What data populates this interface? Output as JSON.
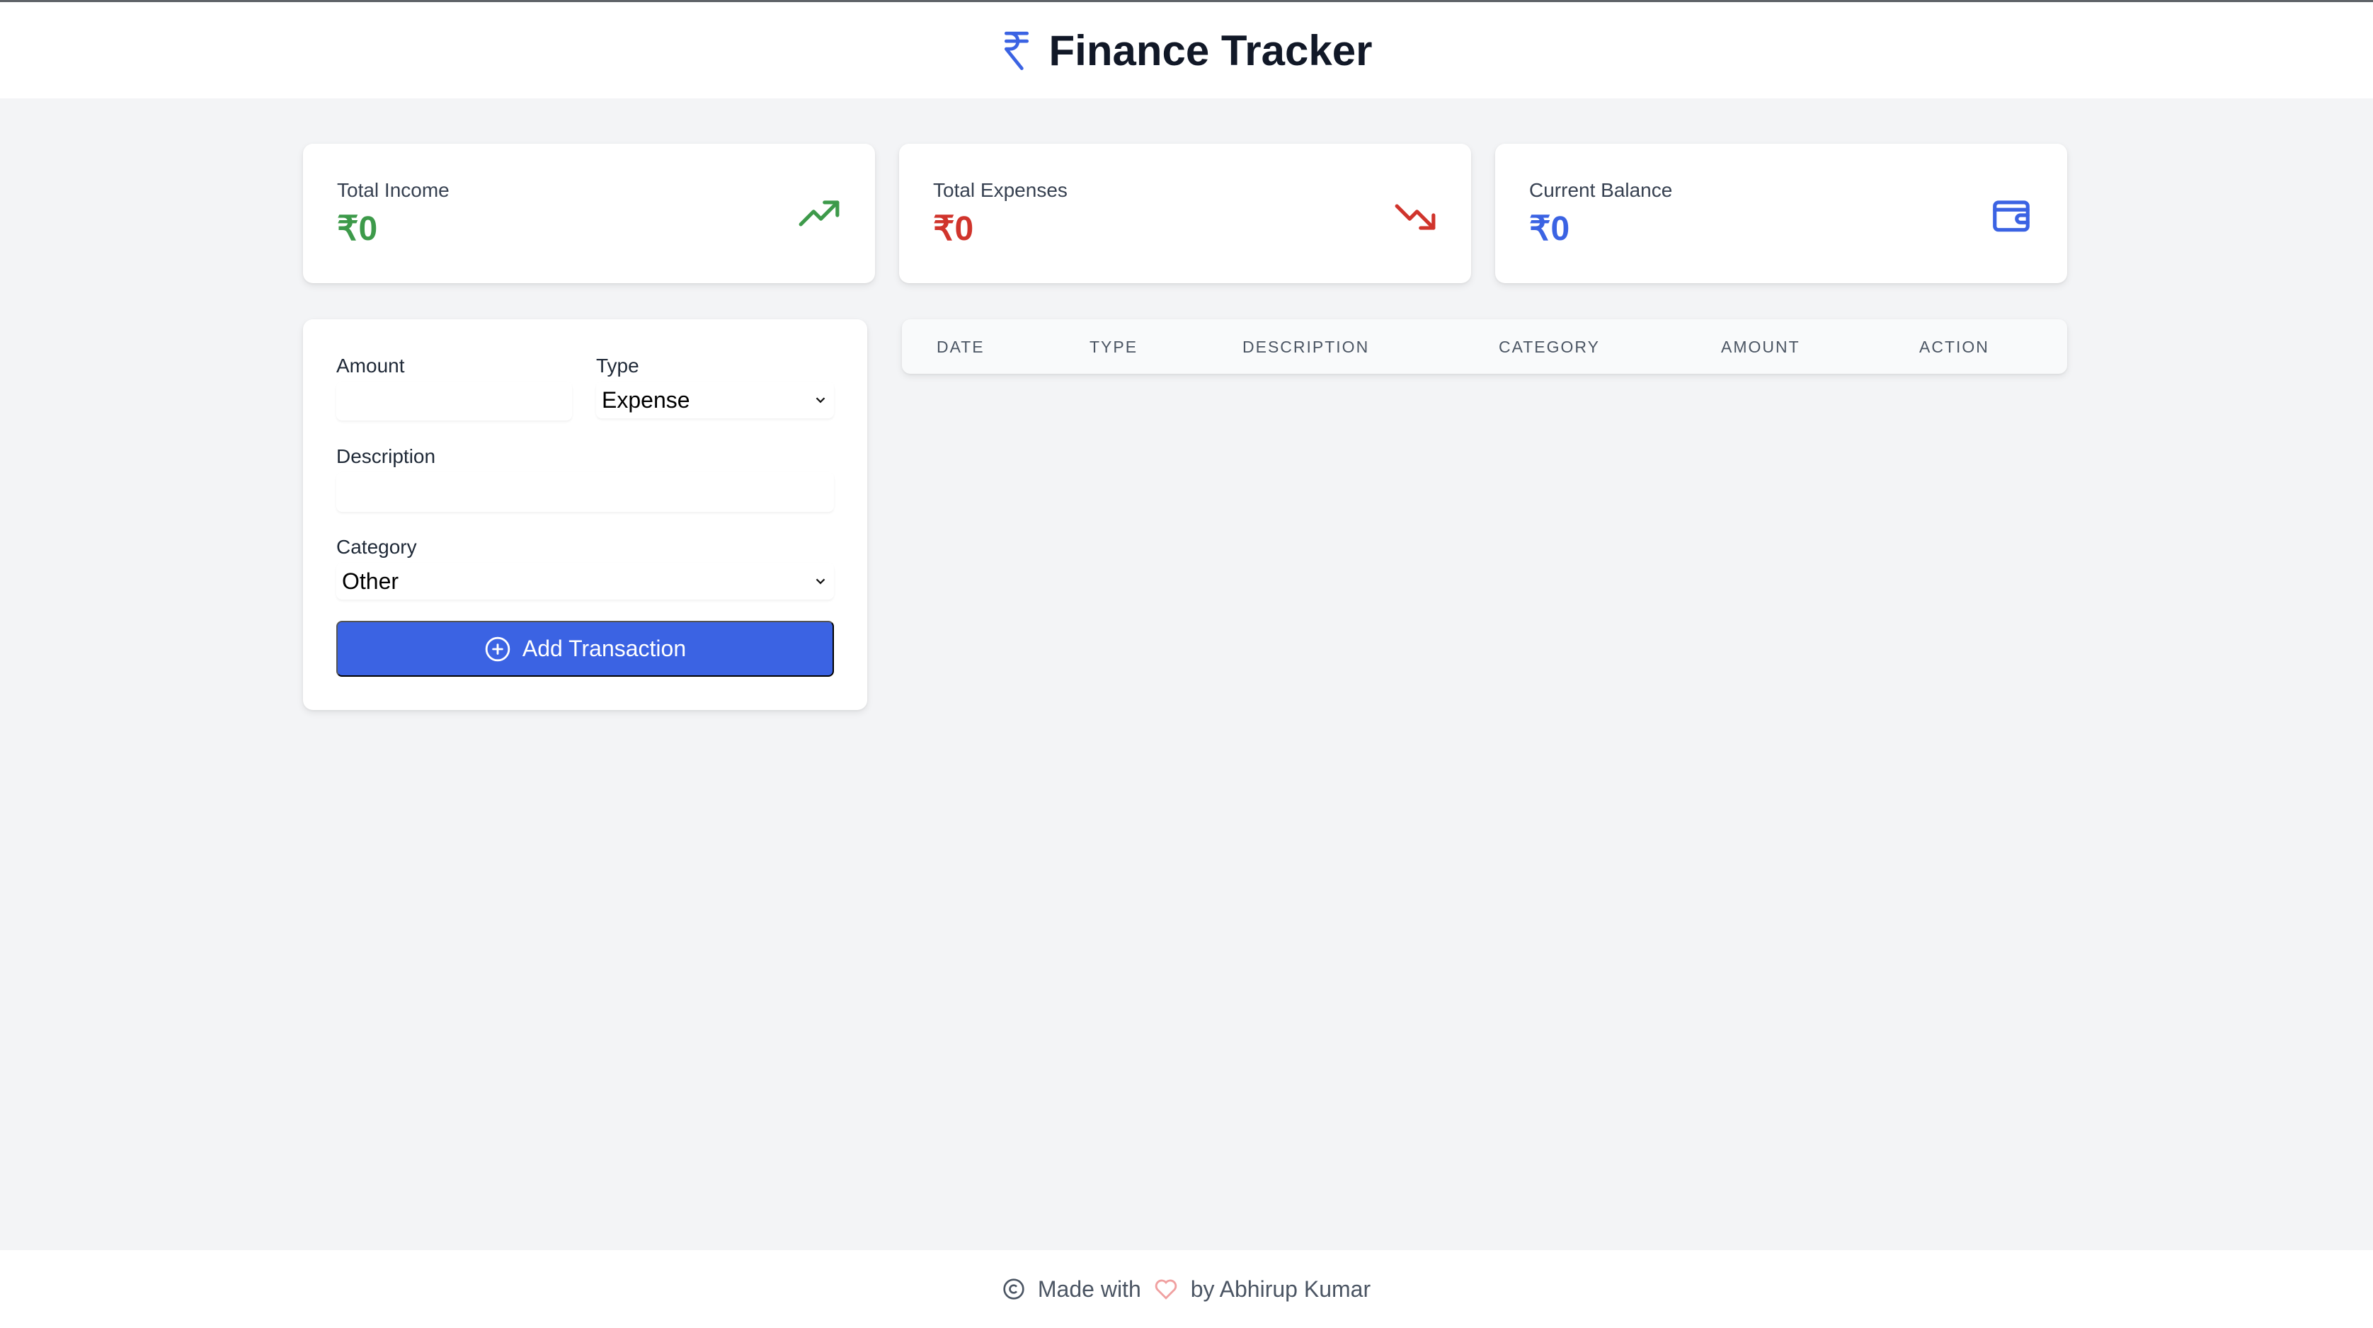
{
  "header": {
    "title": "Finance Tracker",
    "icon": "rupee-icon",
    "accent": "#3b63e3"
  },
  "stats": [
    {
      "label": "Total Income",
      "value": "₹0",
      "color": "#3d9a4a",
      "icon": "trending-up-icon"
    },
    {
      "label": "Total Expenses",
      "value": "₹0",
      "color": "#d0342c",
      "icon": "trending-down-icon"
    },
    {
      "label": "Current Balance",
      "value": "₹0",
      "color": "#3b63e3",
      "icon": "wallet-icon"
    }
  ],
  "form": {
    "amount_label": "Amount",
    "amount_value": "",
    "type_label": "Type",
    "type_value": "Expense",
    "description_label": "Description",
    "description_value": "",
    "category_label": "Category",
    "category_value": "Other",
    "submit_label": "Add Transaction"
  },
  "table": {
    "columns": [
      "DATE",
      "TYPE",
      "DESCRIPTION",
      "CATEGORY",
      "AMOUNT",
      "ACTION"
    ],
    "rows": []
  },
  "footer": {
    "made_with": "Made with",
    "by": "by Abhirup Kumar",
    "heart_color": "#f0a0a0"
  }
}
